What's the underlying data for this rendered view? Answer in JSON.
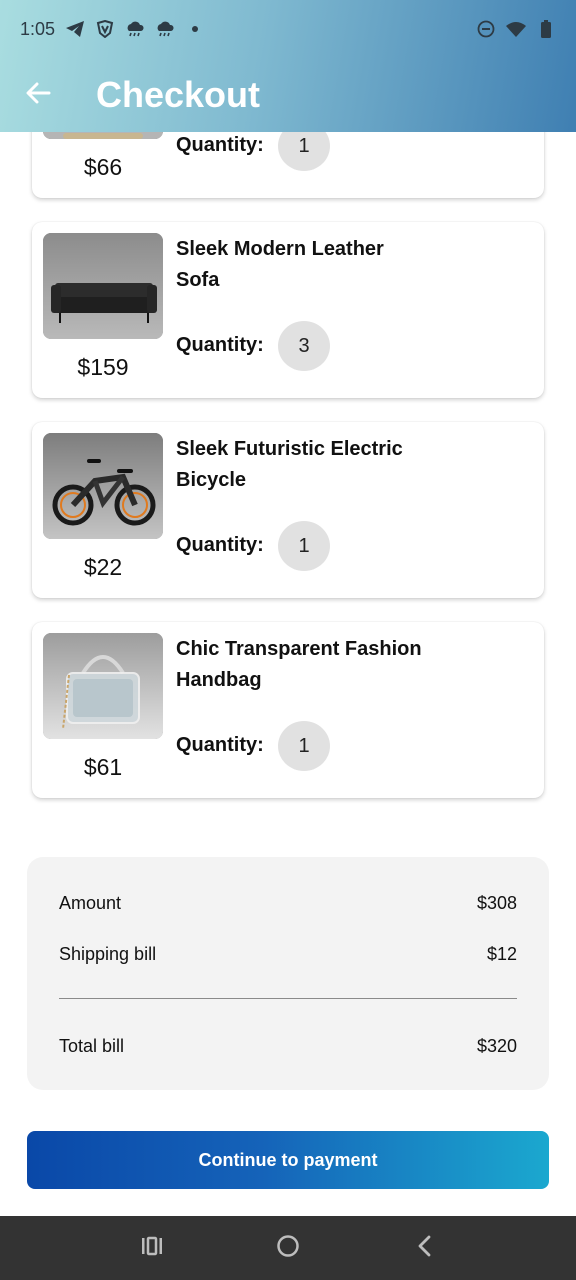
{
  "status_bar": {
    "time": "1:05",
    "left_icons": [
      "telegram-icon",
      "vpn-shield-icon",
      "weather-cloud-icon",
      "weather-cloud-icon",
      "dot-icon"
    ],
    "right_icons": [
      "do-not-disturb-icon",
      "wifi-icon",
      "battery-icon"
    ]
  },
  "header": {
    "title": "Checkout",
    "back_icon": "arrow-left-icon",
    "gradient": [
      "#a9dde0",
      "#3f7fb2"
    ]
  },
  "cart_items": [
    {
      "name": "",
      "price": "$66",
      "quantity_label": "Quantity:",
      "quantity": "1"
    },
    {
      "name": "Sleek Modern Leather Sofa",
      "price": "$159",
      "quantity_label": "Quantity:",
      "quantity": "3"
    },
    {
      "name": "Sleek Futuristic Electric Bicycle",
      "price": "$22",
      "quantity_label": "Quantity:",
      "quantity": "1"
    },
    {
      "name": "Chic Transparent Fashion Handbag",
      "price": "$61",
      "quantity_label": "Quantity:",
      "quantity": "1"
    }
  ],
  "summary": {
    "amount_label": "Amount",
    "amount_value": "$308",
    "shipping_label": "Shipping bill",
    "shipping_value": "$12",
    "total_label": "Total bill",
    "total_value": "$320"
  },
  "actions": {
    "continue_label": "Continue to payment",
    "button_colors": [
      "#0a48a8",
      "#1ba8cf"
    ]
  },
  "nav_bar": {
    "icons": [
      "recent-apps-icon",
      "home-icon",
      "back-nav-icon"
    ]
  }
}
